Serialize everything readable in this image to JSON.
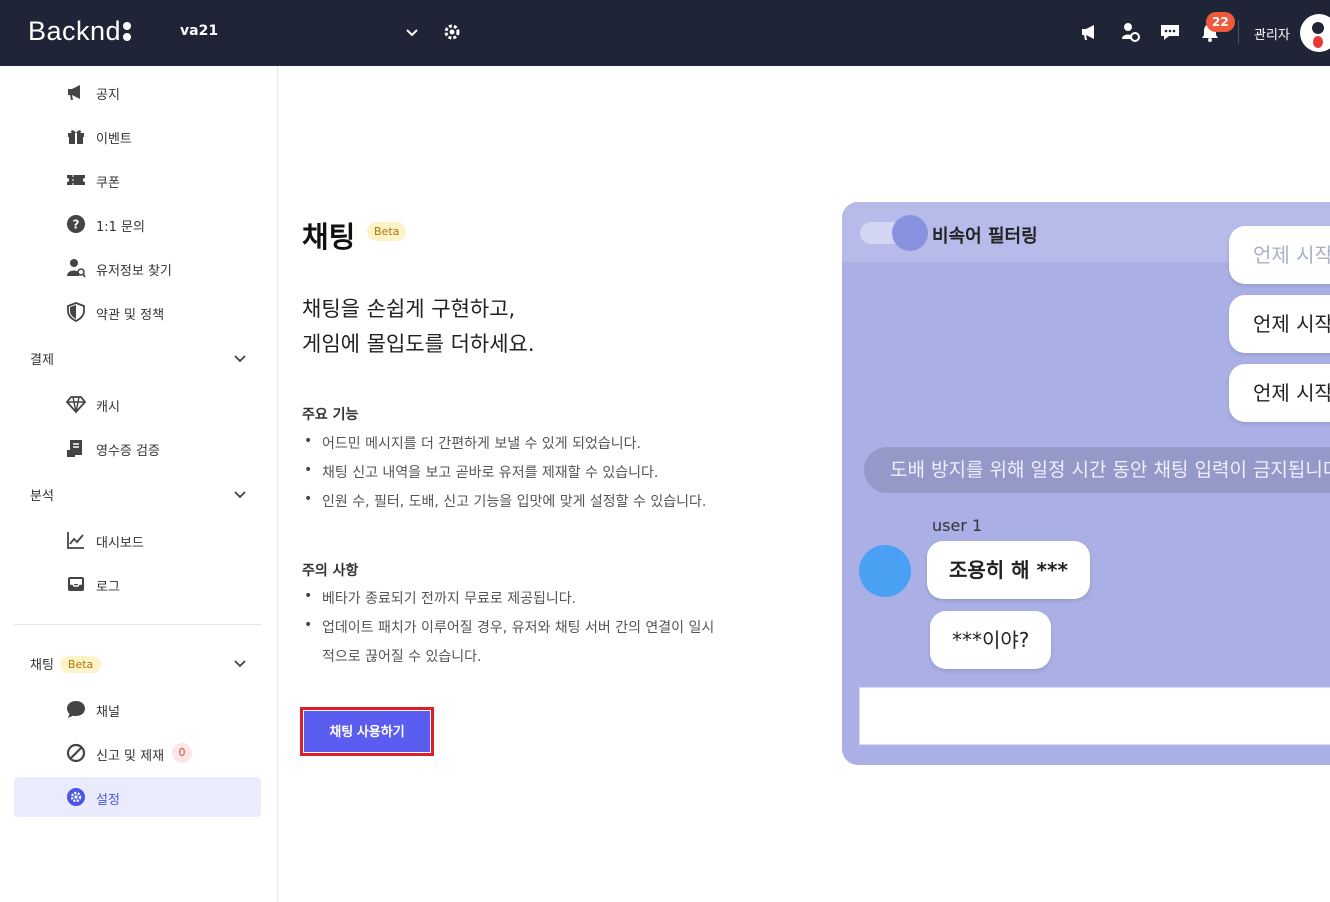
{
  "app": {
    "logo": "Backnd",
    "project": "va21"
  },
  "topbar": {
    "notification_count": "22",
    "user_label": "관리자"
  },
  "sidebar": {
    "items_top": [
      {
        "label": "공지",
        "icon": "megaphone-icon"
      },
      {
        "label": "이벤트",
        "icon": "gift-icon"
      },
      {
        "label": "쿠폰",
        "icon": "ticket-icon"
      },
      {
        "label": "1:1 문의",
        "icon": "question-icon"
      },
      {
        "label": "유저정보 찾기",
        "icon": "user-search-icon"
      },
      {
        "label": "약관 및 정책",
        "icon": "shield-icon"
      }
    ],
    "groups": {
      "payment": {
        "label": "결제",
        "items": [
          {
            "label": "캐시",
            "icon": "diamond-icon"
          },
          {
            "label": "영수증 검증",
            "icon": "receipt-icon"
          }
        ]
      },
      "analytics": {
        "label": "분석",
        "items": [
          {
            "label": "대시보드",
            "icon": "chart-icon"
          },
          {
            "label": "로그",
            "icon": "inbox-icon"
          }
        ]
      },
      "chat": {
        "label": "채팅",
        "badge": "Beta",
        "items": [
          {
            "label": "채널",
            "icon": "chat-bubble-icon"
          },
          {
            "label": "신고 및 제재",
            "icon": "ban-icon",
            "count": "0"
          },
          {
            "label": "설정",
            "icon": "settings-icon"
          }
        ]
      }
    }
  },
  "main": {
    "title": "채팅",
    "title_badge": "Beta",
    "subtitle_line1": "채팅을 손쉽게 구현하고,",
    "subtitle_line2": "게임에 몰입도를 더하세요.",
    "features_title": "주요 기능",
    "features": [
      "어드민 메시지를 더 간편하게 보낼 수 있게 되었습니다.",
      "채팅 신고 내역을 보고 곧바로 유저를 제재할 수 있습니다.",
      "인원 수, 필터, 도배, 신고 기능을 입맛에 맞게 설정할 수 있습니다."
    ],
    "notes_title": "주의 사항",
    "notes": [
      "베타가 종료되기 전까지 무료로 제공됩니다.",
      "업데이트 패치가 이루어질 경우, 유저와 채팅 서버 간의 연결이 일시",
      "적으로 끊어질 수 있습니다."
    ],
    "cta_label": "채팅 사용하기"
  },
  "preview": {
    "filter_label": "비속어 필터링",
    "right_bubbles": [
      "언제 시작",
      "언제 시작",
      "언제 시작"
    ],
    "system_message": "도배 방지를 위해 일정 시간 동안 채팅 입력이 금지됩니다",
    "user_name": "user 1",
    "user_messages": [
      "조용히 해 ***",
      "***이야?"
    ]
  },
  "colors": {
    "topbar": "#1f2437",
    "accent": "#5b5cf0",
    "cta_outline": "#e11d2a",
    "preview_bg": "#aab0e6"
  }
}
